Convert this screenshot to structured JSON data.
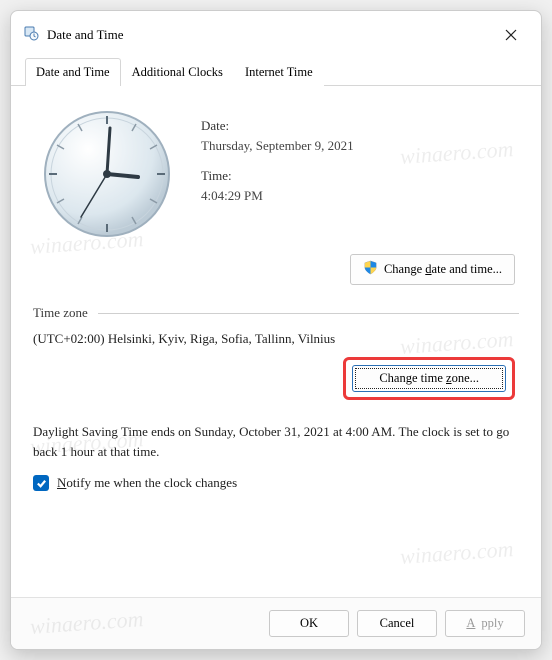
{
  "window": {
    "title": "Date and Time"
  },
  "tabs": [
    "Date and Time",
    "Additional Clocks",
    "Internet Time"
  ],
  "date": {
    "label": "Date:",
    "value": "Thursday, September 9, 2021"
  },
  "time": {
    "label": "Time:",
    "value": "4:04:29 PM"
  },
  "change_datetime_btn": "Change date and time...",
  "timezone": {
    "header": "Time zone",
    "value": "(UTC+02:00) Helsinki, Kyiv, Riga, Sofia, Tallinn, Vilnius",
    "change_btn": "Change time zone..."
  },
  "dst_text": "Daylight Saving Time ends on Sunday, October 31, 2021 at 4:00 AM. The clock is set to go back 1 hour at that time.",
  "notify_checkbox": {
    "checked": true,
    "label": "Notify me when the clock changes"
  },
  "footer": {
    "ok": "OK",
    "cancel": "Cancel",
    "apply": "Apply"
  },
  "watermark": "winaero.com"
}
